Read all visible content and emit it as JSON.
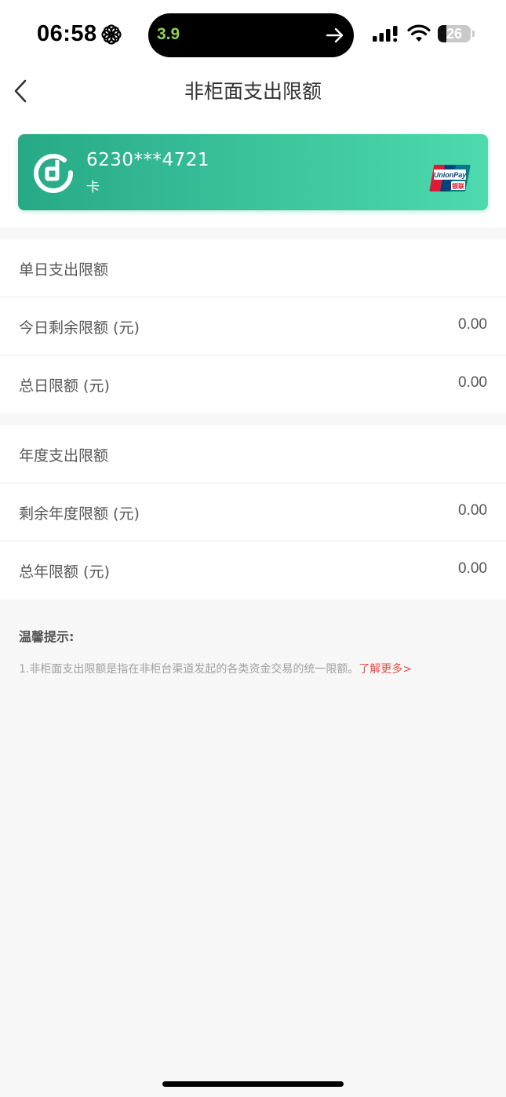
{
  "status_bar": {
    "time": "06:58",
    "island_value": "3.9",
    "battery_level": "26",
    "icons": [
      "flower-icon",
      "arrow-right-icon",
      "signal-icon",
      "wifi-icon",
      "battery-icon"
    ]
  },
  "nav": {
    "back_icon": "chevron-left-icon",
    "title": "非柜面支出限额"
  },
  "card": {
    "number": "6230***4721",
    "type": "卡",
    "logo": "bank-logo-icon",
    "network_icon": "unionpay-icon",
    "gradient_start": "#27a986",
    "gradient_end": "#4ed9ae"
  },
  "daily": {
    "header": "单日支出限额",
    "rows": [
      {
        "label": "今日剩余限额 (元)",
        "value": "0.00"
      },
      {
        "label": "总日限额 (元)",
        "value": "0.00"
      }
    ]
  },
  "yearly": {
    "header": "年度支出限额",
    "rows": [
      {
        "label": "剩余年度限额 (元)",
        "value": "0.00"
      },
      {
        "label": "总年限额 (元)",
        "value": "0.00"
      }
    ]
  },
  "tips": {
    "title": "温馨提示:",
    "body": "1.非柜面支出限额是指在非柜台渠道发起的各类资金交易的统一限额。",
    "link": "了解更多>",
    "link_color": "#e0504a"
  }
}
